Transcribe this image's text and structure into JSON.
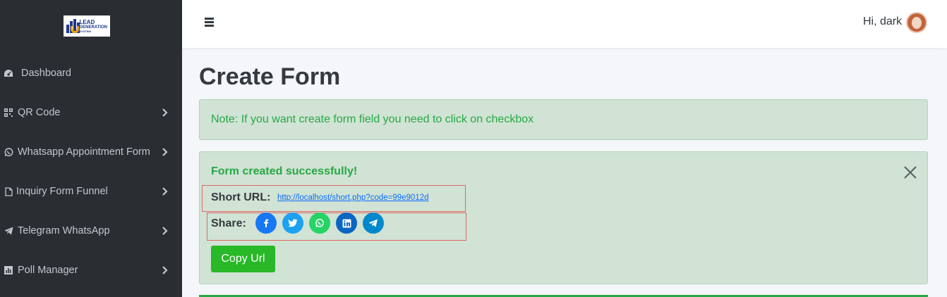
{
  "brand": {
    "logo_line1": "LEAD",
    "logo_line2": "GENERATION",
    "logo_line3": "SYSTEM"
  },
  "sidebar": {
    "items": [
      {
        "label": "Dashboard",
        "icon": "dashboard-icon",
        "has_children": false
      },
      {
        "label": "QR Code",
        "icon": "qr-code-icon",
        "has_children": true
      },
      {
        "label": "Whatsapp Appointment Form",
        "icon": "whatsapp-icon",
        "has_children": true
      },
      {
        "label": "Inquiry Form Funnel",
        "icon": "file-icon",
        "has_children": true
      },
      {
        "label": "Telegram WhatsApp",
        "icon": "telegram-icon",
        "has_children": true
      },
      {
        "label": "Poll Manager",
        "icon": "chart-icon",
        "has_children": true
      }
    ]
  },
  "header": {
    "greeting": "Hi, dark",
    "menu_icon": "hamburger-icon",
    "avatar_icon": "user-avatar"
  },
  "main": {
    "title": "Create Form",
    "note": "Note: If you want create form field you need to click on checkbox",
    "success": {
      "title": "Form created successfully!",
      "short_url_label": "Short URL:",
      "short_url": "http://localhost/short.php?code=99e9012d",
      "share_label": "Share:",
      "share_buttons": [
        {
          "name": "facebook",
          "icon": "facebook-icon",
          "color": "#1877f2"
        },
        {
          "name": "twitter",
          "icon": "twitter-icon",
          "color": "#1da1f2"
        },
        {
          "name": "whatsapp",
          "icon": "whatsapp-icon",
          "color": "#25d366"
        },
        {
          "name": "linkedin",
          "icon": "linkedin-icon",
          "color": "#0a66c2"
        },
        {
          "name": "telegram",
          "icon": "telegram-icon",
          "color": "#0088cc"
        }
      ],
      "copy_button": "Copy Url"
    }
  },
  "colors": {
    "sidebar_bg": "#2a2d31",
    "success_bg": "#d0e3d4",
    "success_text": "#28a745",
    "highlight_border": "#e06666"
  }
}
